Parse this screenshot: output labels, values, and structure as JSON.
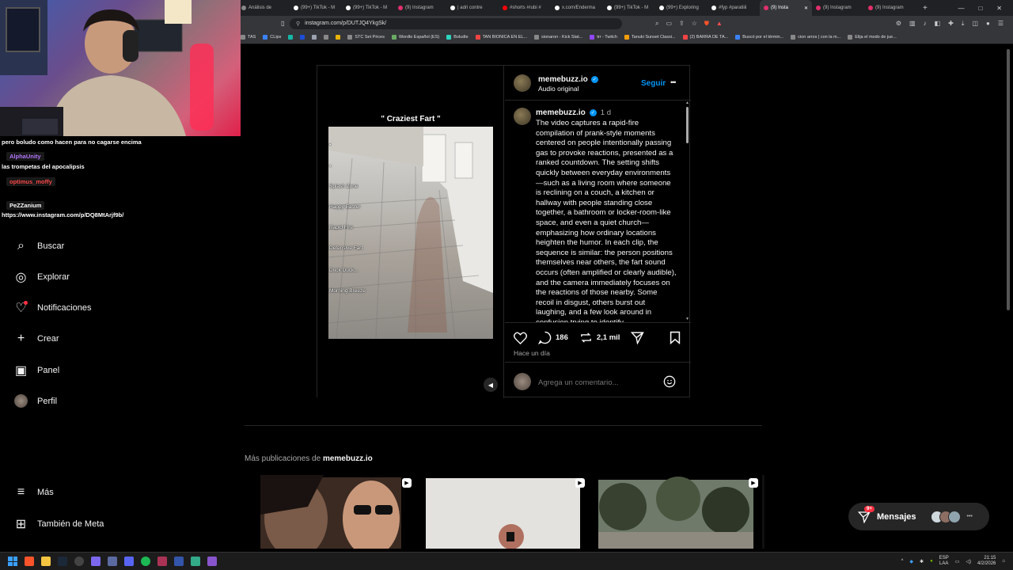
{
  "browser": {
    "tabs": [
      {
        "label": "Análisis de",
        "color": "#888",
        "active": false
      },
      {
        "label": "(99+) TikTok - M",
        "color": "#fff",
        "active": false
      },
      {
        "label": "(99+) TikTok - M",
        "color": "#fff",
        "active": false
      },
      {
        "label": "(9) Instagram",
        "color": "#e1306c",
        "active": false
      },
      {
        "label": "| adri contre",
        "color": "#fff",
        "active": false
      },
      {
        "label": "#shorts #rubi #",
        "color": "#ff0000",
        "active": false
      },
      {
        "label": "x.com/Enderma",
        "color": "#fff",
        "active": false
      },
      {
        "label": "(99+) TikTok - M",
        "color": "#fff",
        "active": false
      },
      {
        "label": "(99+) Exploring",
        "color": "#fff",
        "active": false
      },
      {
        "label": "#fyp #paratiiii",
        "color": "#fff",
        "active": false
      },
      {
        "label": "(9) Insta",
        "color": "#e1306c",
        "active": true
      },
      {
        "label": "(9) Instagram",
        "color": "#e1306c",
        "active": false
      },
      {
        "label": "(9) Instagram",
        "color": "#e1306c",
        "active": false
      }
    ],
    "new_tab": "+",
    "url": "instagram.com/p/DUTJQ4YkgSk/",
    "bookmarks": [
      {
        "label": "TAS",
        "color": "#888"
      },
      {
        "label": "CLips",
        "color": "#3b82f6"
      },
      {
        "label": "",
        "color": "#14b8a6"
      },
      {
        "label": "",
        "color": "#1d4ed8"
      },
      {
        "label": "",
        "color": "#9ca3af"
      },
      {
        "label": "",
        "color": "#888"
      },
      {
        "label": "",
        "color": "#eab308"
      },
      {
        "label": "STC Set Prices",
        "color": "#888"
      },
      {
        "label": "Wordle Español (ES)",
        "color": "#6aaa64"
      },
      {
        "label": "Boludle",
        "color": "#2dd4bf"
      },
      {
        "label": "TAN BIONICA EN EL...",
        "color": "#ef4444"
      },
      {
        "label": "sionaron - Kick Stat...",
        "color": "#888"
      },
      {
        "label": "trr - Twitch",
        "color": "#9146ff"
      },
      {
        "label": "Tanuki Sunset Classi...",
        "color": "#f59e0b"
      },
      {
        "label": "(2) BARRA DE TA...",
        "color": "#ef4444"
      },
      {
        "label": "Buscó por el términ...",
        "color": "#3b82f6"
      },
      {
        "label": "cion arros | con la m...",
        "color": "#888"
      },
      {
        "label": "Elija el modo de jue...",
        "color": "#888"
      }
    ]
  },
  "stream_chat": {
    "lines": [
      {
        "text": "pero boludo como hacen para no cagarse encima",
        "kind": "msg"
      },
      {
        "text": "AlphaUnity",
        "kind": "user",
        "color": "#b77cff"
      },
      {
        "text": "las trompetas del apocalipsis",
        "kind": "msg"
      },
      {
        "text": "optimus_moffy",
        "kind": "user",
        "color": "#ff4d4d"
      },
      {
        "text": "PeZZanium",
        "kind": "user",
        "color": "#ffffff"
      },
      {
        "text": "https://www.instagram.com/p/DQ8MtArjf9b/",
        "kind": "msg"
      }
    ]
  },
  "sidebar": {
    "items": [
      {
        "label": "Buscar",
        "icon": "search-icon"
      },
      {
        "label": "Explorar",
        "icon": "compass-icon"
      },
      {
        "label": "Notificaciones",
        "icon": "heart-icon"
      },
      {
        "label": "Crear",
        "icon": "plus-icon"
      },
      {
        "label": "Panel",
        "icon": "chart-icon"
      },
      {
        "label": "Perfil",
        "icon": "avatar-icon"
      }
    ],
    "bottom": [
      {
        "label": "Más",
        "icon": "menu-icon"
      },
      {
        "label": "También de Meta",
        "icon": "meta-grid-icon"
      }
    ]
  },
  "post": {
    "video": {
      "title": "\" Craziest Fart \"",
      "ranks": [
        "Splash Zone",
        "Happy Easter",
        "Rapid Fire",
        "Defensive Fart",
        "Duck Duck...",
        "Morning Breeze"
      ]
    },
    "header": {
      "username": "memebuzz.io",
      "subtitle": "Audio original",
      "follow": "Seguir",
      "more": "•••"
    },
    "caption": {
      "username": "memebuzz.io",
      "time": "1 d",
      "text": "The video captures a rapid-fire compilation of prank-style moments centered on people intentionally passing gas to provoke reactions, presented as a ranked countdown. The setting shifts quickly between everyday environments—such as a living room where someone is reclining on a couch, a kitchen or hallway with people standing close together, a bathroom or locker-room-like space, and even a quiet church—emphasizing how ordinary locations heighten the humor. In each clip, the sequence is similar: the person positions themselves near others, the fart sound occurs (often amplified or clearly audible), and the camera immediately focuses on the reactions of those nearby. Some recoil in disgust, others burst out laughing, and a few look around in confusion trying to identify"
    },
    "actions": {
      "comments": "186",
      "reposts": "2,1 mil",
      "time_ago": "Hace un día",
      "comment_placeholder": "Agrega un comentario..."
    }
  },
  "more_posts": {
    "prefix": "Más publicaciones de",
    "username": "memebuzz.io"
  },
  "messages": {
    "label": "Mensajes",
    "badge": "9+"
  },
  "taskbar": {
    "lang": "ESP",
    "lang2": "LAA",
    "time": "21:15",
    "date": "4/2/2026"
  }
}
